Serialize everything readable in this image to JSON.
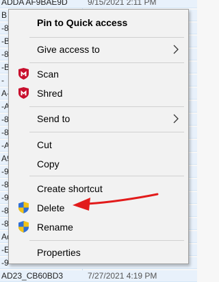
{
  "background": {
    "rows": [
      {
        "name": "ADDA AF9BAE9D",
        "date": "9/15/2021 2:11 PM"
      },
      {
        "name": "B",
        "date": ""
      },
      {
        "name": "-8",
        "date": ""
      },
      {
        "name": "-B",
        "date": ""
      },
      {
        "name": "-8",
        "date": ""
      },
      {
        "name": "-B",
        "date": ""
      },
      {
        "name": "-",
        "date": ""
      },
      {
        "name": "A-",
        "date": ""
      },
      {
        "name": "-A",
        "date": ""
      },
      {
        "name": "-8",
        "date": ""
      },
      {
        "name": "-8",
        "date": ""
      },
      {
        "name": "-A",
        "date": ""
      },
      {
        "name": "A9",
        "date": ""
      },
      {
        "name": "-9",
        "date": ""
      },
      {
        "name": "-8",
        "date": ""
      },
      {
        "name": "-9",
        "date": ""
      },
      {
        "name": "-8",
        "date": ""
      },
      {
        "name": "-8",
        "date": ""
      },
      {
        "name": "Ad",
        "date": ""
      },
      {
        "name": "-E",
        "date": ""
      },
      {
        "name": "-9",
        "date": ""
      },
      {
        "name": "AD23_CB60BD3",
        "date": "7/27/2021 4:19 PM"
      }
    ]
  },
  "menu": {
    "pin": "Pin to Quick access",
    "give_access": "Give access to",
    "scan": "Scan",
    "shred": "Shred",
    "send_to": "Send to",
    "cut": "Cut",
    "copy": "Copy",
    "create_shortcut": "Create shortcut",
    "delete": "Delete",
    "rename": "Rename",
    "properties": "Properties"
  },
  "icons": {
    "mcafee": "mcafee-shield-icon",
    "uac": "uac-shield-icon",
    "chevron": "chevron-right-icon"
  },
  "colors": {
    "mcafee_red": "#c8102e",
    "arrow_red": "#e21b1b",
    "uac_blue": "#2f6fd6",
    "uac_yellow": "#f3c318"
  }
}
